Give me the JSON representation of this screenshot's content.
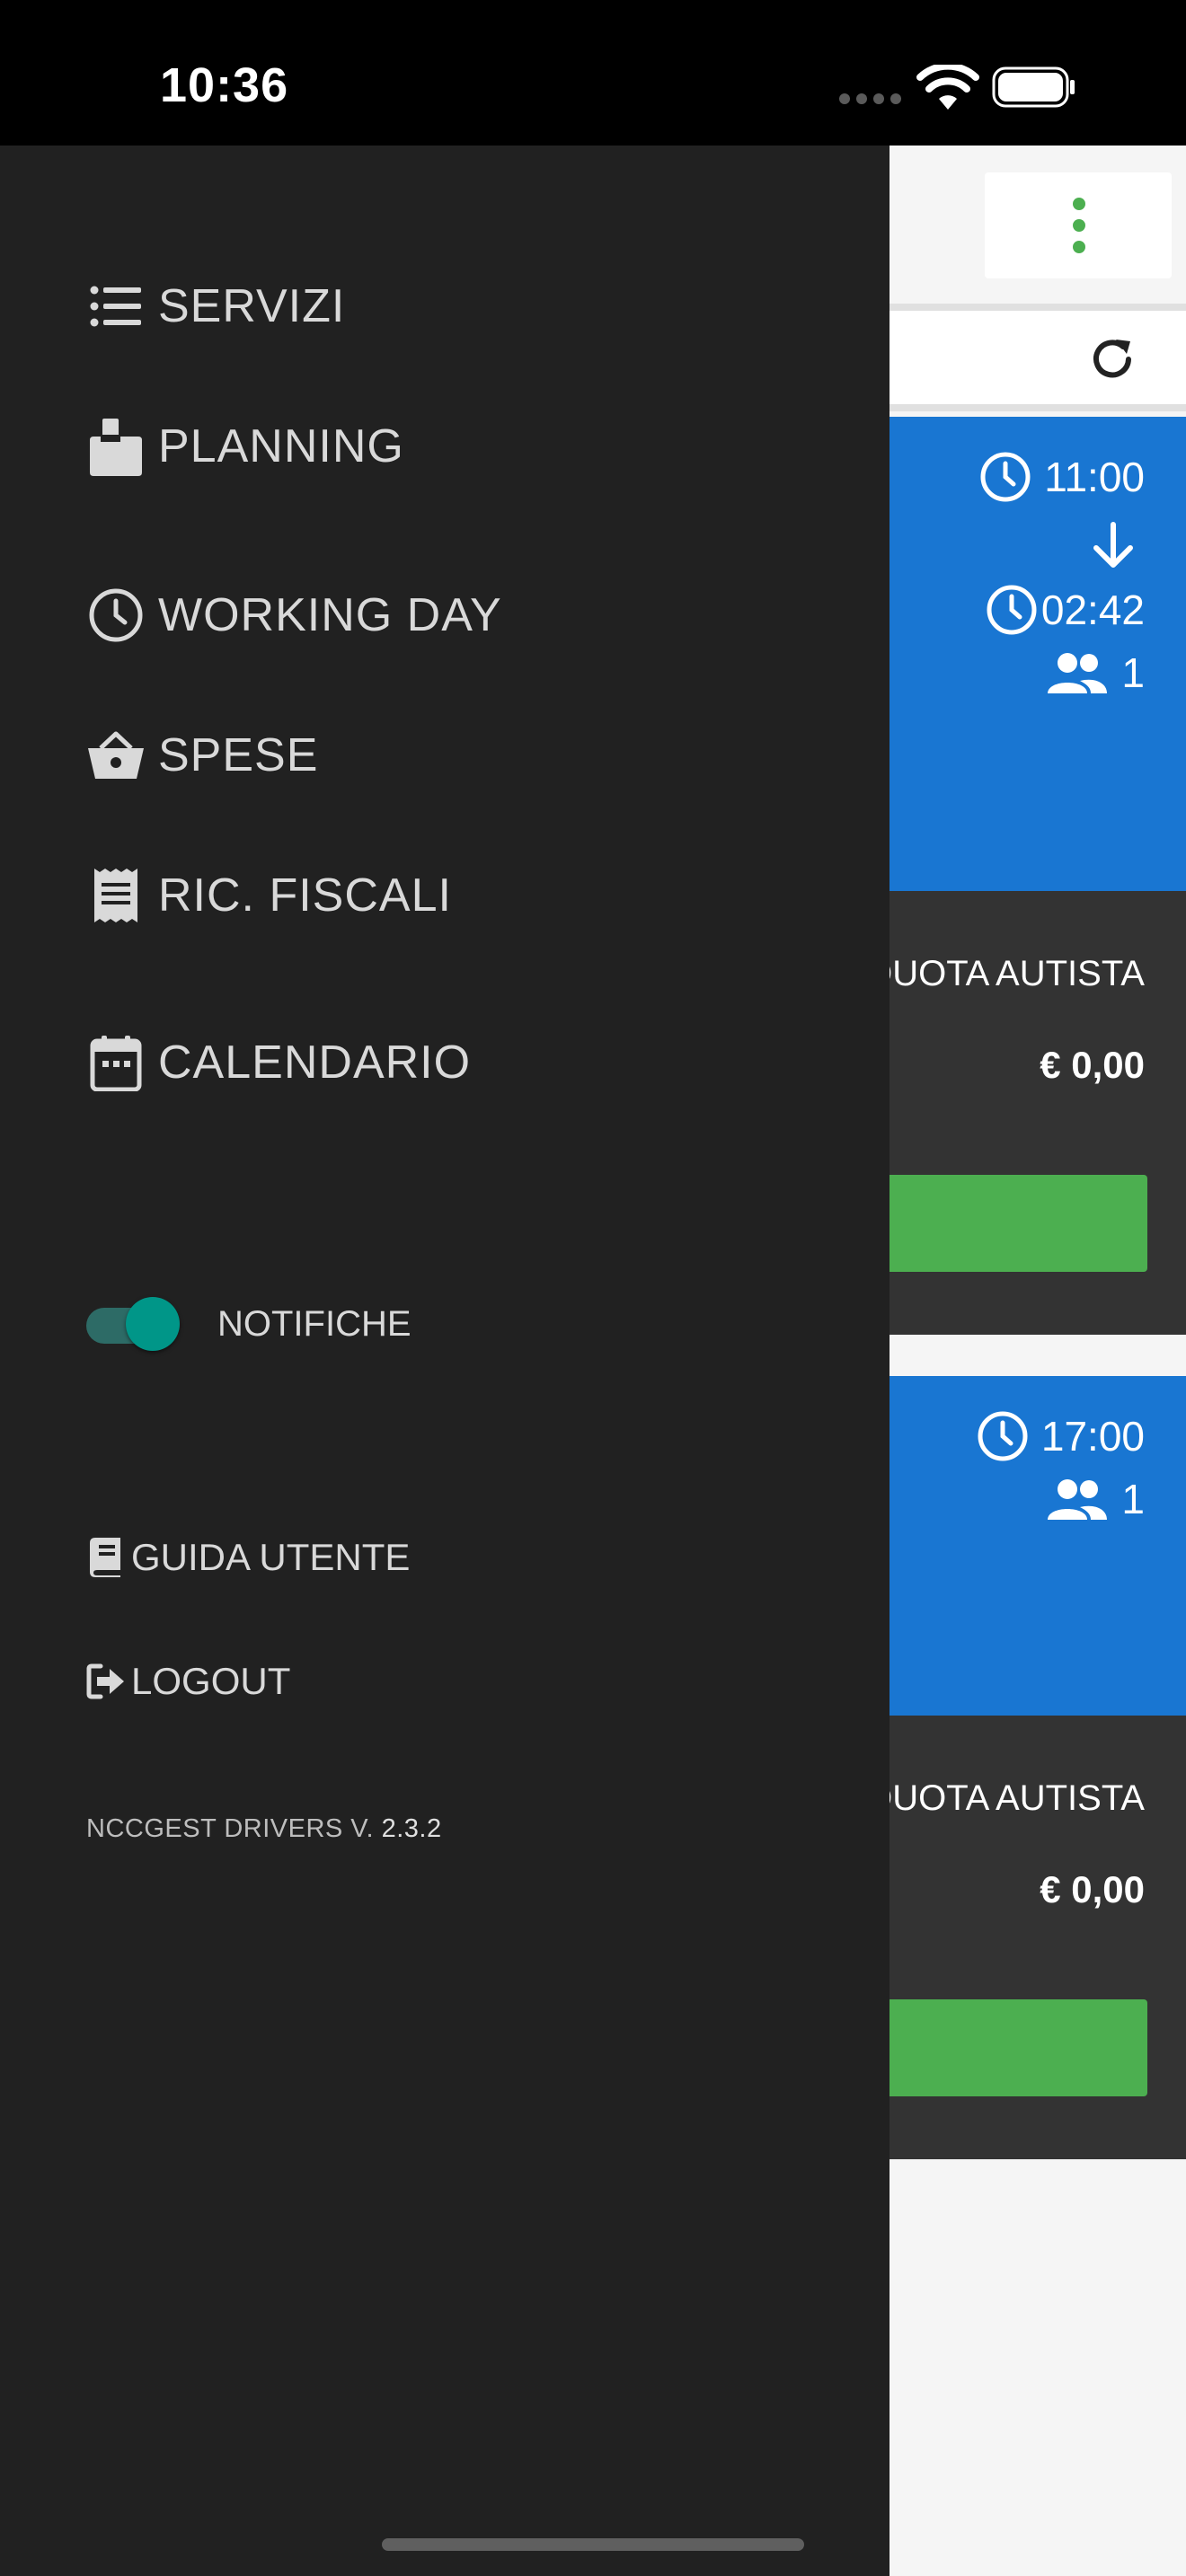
{
  "status_bar": {
    "time": "10:36"
  },
  "background": {
    "cards": [
      {
        "start_time": "11:00",
        "duration": "02:42",
        "passengers": "1",
        "quota_label": "QUOTA AUTISTA",
        "quota_value": "€ 0,00"
      },
      {
        "start_time": "17:00",
        "passengers": "1",
        "quota_label": "QUOTA AUTISTA",
        "quota_value": "€ 0,00"
      }
    ],
    "colors": {
      "card_header": "#1976d2",
      "card_body": "#333333",
      "action_button": "#4caf50"
    }
  },
  "drawer": {
    "nav_items": [
      {
        "label": "SERVIZI",
        "icon": "list-icon"
      },
      {
        "label": "PLANNING",
        "icon": "mailbox-icon"
      },
      {
        "label": "WORKING DAY",
        "icon": "clock-icon"
      },
      {
        "label": "SPESE",
        "icon": "basket-icon"
      },
      {
        "label": "RIC. FISCALI",
        "icon": "receipt-icon"
      },
      {
        "label": "CALENDARIO",
        "icon": "calendar-icon"
      }
    ],
    "notifications": {
      "label": "NOTIFICHE",
      "enabled": true
    },
    "links": [
      {
        "label": "GUIDA UTENTE",
        "icon": "book-icon"
      },
      {
        "label": "LOGOUT",
        "icon": "logout-icon"
      }
    ],
    "version_prefix": "NCCGEST DRIVERS V.",
    "version_number": "2.3.2",
    "colors": {
      "background": "#212121",
      "text": "#d9d9d9",
      "toggle_accent": "#009688"
    }
  }
}
